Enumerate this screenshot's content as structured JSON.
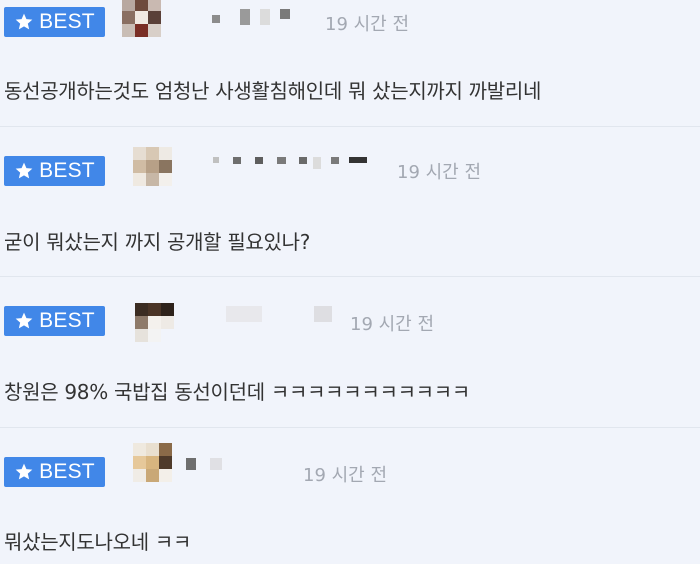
{
  "badge_label": "BEST",
  "badge_icon": "star-icon",
  "colors": {
    "badge_bg": "#4187e8",
    "time_text": "#a3a8b2",
    "body_text": "#333333",
    "background": "#f1f4fb"
  },
  "comments": [
    {
      "time": "19 시간 전",
      "text": "동선공개하는것도 엄청난 사생활침해인데 뭐 샀는지까지 까발리네"
    },
    {
      "time": "19 시간 전",
      "text": "굳이 뭐샀는지 까지 공개할 필요있나?"
    },
    {
      "time": "19 시간 전",
      "text": "창원은 98% 국밥집 동선이던데 ㅋㅋㅋㅋㅋㅋㅋㅋㅋㅋㅋ"
    },
    {
      "time": "19 시간 전",
      "text": "뭐샀는지도나오네 ㅋㅋ"
    }
  ]
}
